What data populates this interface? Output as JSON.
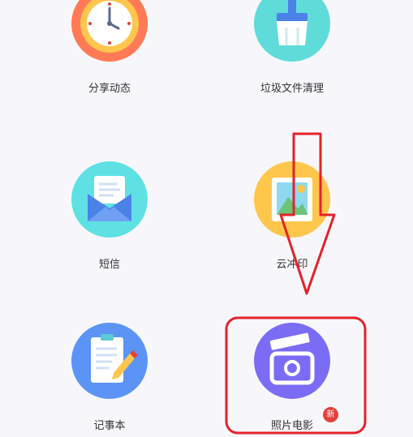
{
  "tiles": [
    {
      "id": "share",
      "label": "分享动态",
      "icon": "clock-icon",
      "color": "#ff7a55"
    },
    {
      "id": "cleanup",
      "label": "垃圾文件清理",
      "icon": "brush-icon",
      "color": "#5fdbd9"
    },
    {
      "id": "sms",
      "label": "短信",
      "icon": "envelope-icon",
      "color": "#5fe1e3"
    },
    {
      "id": "cloud-print",
      "label": "云冲印",
      "icon": "photo-frame-icon",
      "color": "#ffc64c"
    },
    {
      "id": "notepad",
      "label": "记事本",
      "icon": "clipboard-pencil-icon",
      "color": "#5b94f4"
    },
    {
      "id": "photo-movie",
      "label": "照片电影",
      "icon": "clapperboard-icon",
      "color": "#7b6cf6",
      "badge": "新"
    }
  ],
  "annotation": {
    "color": "#e5222a"
  }
}
